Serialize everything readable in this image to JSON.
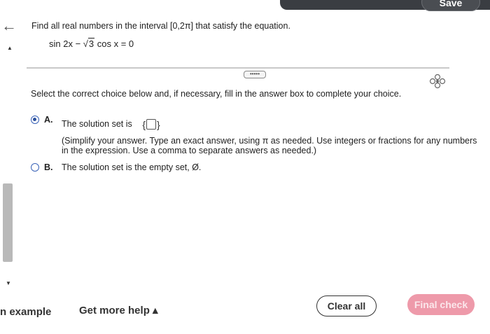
{
  "header": {
    "save_label": "Save"
  },
  "question": {
    "prompt": "Find all real numbers in the interval [0,2π] that satisfy the equation.",
    "equation": {
      "part1": "sin 2x − ",
      "sqrt": "3",
      "part2": " cos x = 0"
    }
  },
  "instruction": "Select the correct choice below and, if necessary, fill in the answer box to complete your choice.",
  "choices": {
    "a": {
      "letter": "A.",
      "text": "The solution set is",
      "answer_value": "",
      "hint_line1": "(Simplify your answer. Type an exact answer, using π as needed. Use integers or fractions for any numbers",
      "hint_line2": "in the expression. Use a comma to separate answers as needed.)",
      "selected": true
    },
    "b": {
      "letter": "B.",
      "text": "The solution set is the empty set, Ø.",
      "selected": false
    }
  },
  "footer": {
    "example_label": "n example",
    "help_label": "Get more help ▴",
    "clear_label": "Clear all",
    "final_label": "Final check"
  },
  "colors": {
    "accent": "#2a4f9c",
    "final_check_bg": "#ee9aaa",
    "header_bg": "#3a3d42"
  },
  "icons": [
    "back-arrow-icon",
    "settings-icon",
    "more-dots-icon"
  ]
}
